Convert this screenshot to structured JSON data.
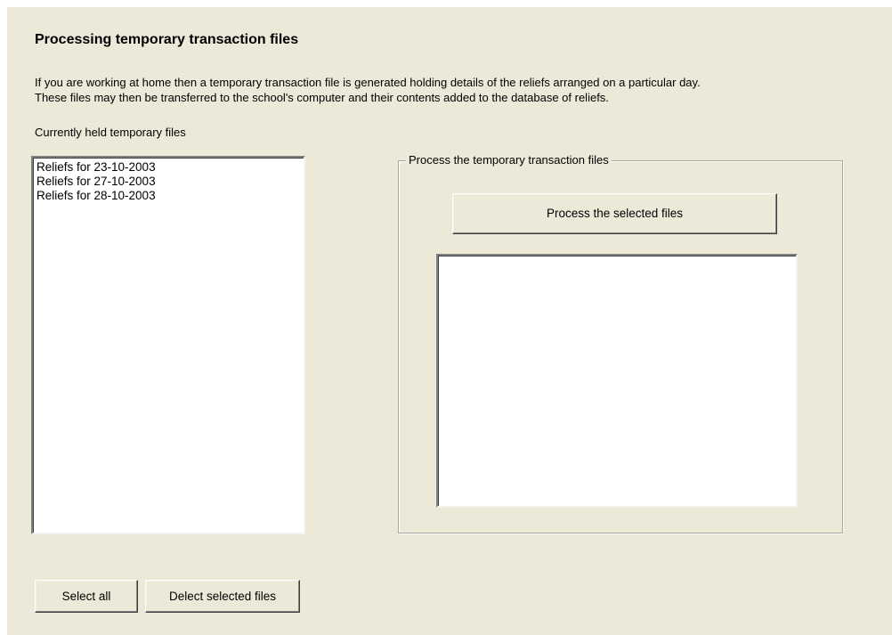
{
  "header": {
    "title": "Processing temporary transaction files"
  },
  "description": {
    "line1": "If you are working at home then a temporary transaction file is generated holding details of the reliefs arranged on a particular day.",
    "line2": "These files may then be transferred to the school's computer and  their contents added to the database of reliefs."
  },
  "file_list": {
    "label": "Currently held temporary files",
    "items": [
      "Reliefs for 23-10-2003",
      "Reliefs for 27-10-2003",
      "Reliefs for 28-10-2003"
    ]
  },
  "process_group": {
    "legend": "Process the temporary transaction files",
    "process_button_label": "Process the selected files",
    "output_text": ""
  },
  "bottom_buttons": {
    "select_all_label": "Select all",
    "delete_label": "Delect selected files"
  }
}
